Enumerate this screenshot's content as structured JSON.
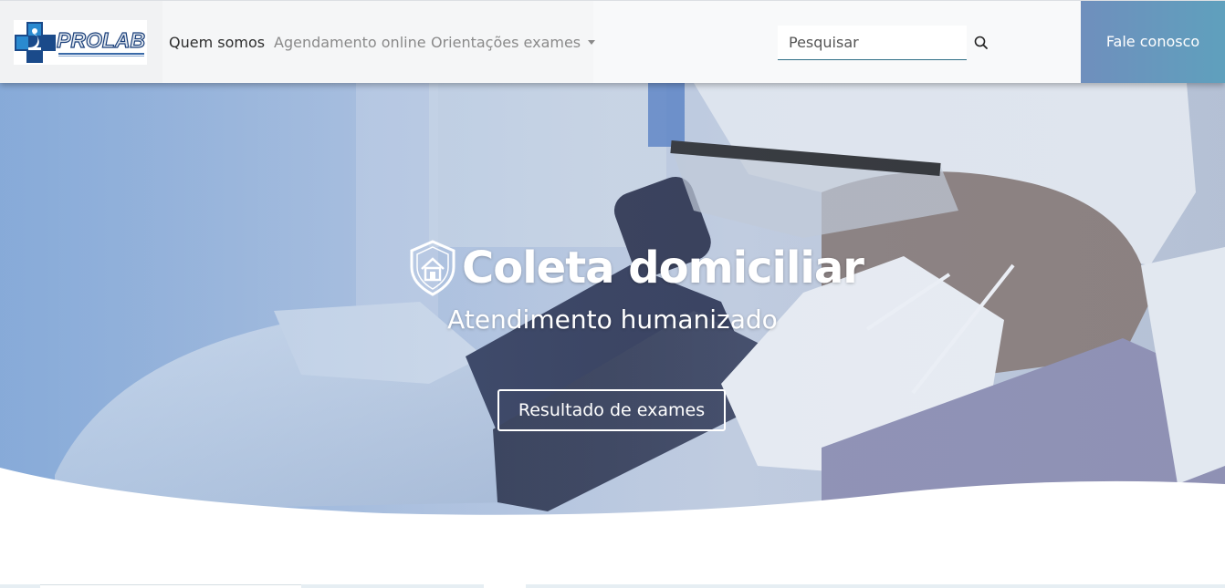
{
  "brand": {
    "logo_text": "PROLAB",
    "logo_subtitle": "LABORATÓRIO DE ANÁLISES CLÍNICAS"
  },
  "nav": {
    "items": [
      {
        "label": "Quem somos",
        "active": true
      },
      {
        "label": "Agendamento online",
        "active": false
      },
      {
        "label": "Orientações exames",
        "active": false,
        "dropdown": true
      }
    ]
  },
  "search": {
    "placeholder": "Pesquisar",
    "icon": "search-icon"
  },
  "cta": {
    "label": "Fale conosco"
  },
  "hero": {
    "icon": "shield-home-icon",
    "title": "Coleta domiciliar",
    "subtitle": "Atendimento humanizado",
    "button_label": "Resultado de exames"
  },
  "colors": {
    "navbar_bg": "#f8f9fa",
    "cta_gradient_start": "#6f8fbd",
    "cta_gradient_end": "#5fa0bd",
    "logo_blue": "#1a3f7a",
    "hero_text": "#ffffff"
  }
}
